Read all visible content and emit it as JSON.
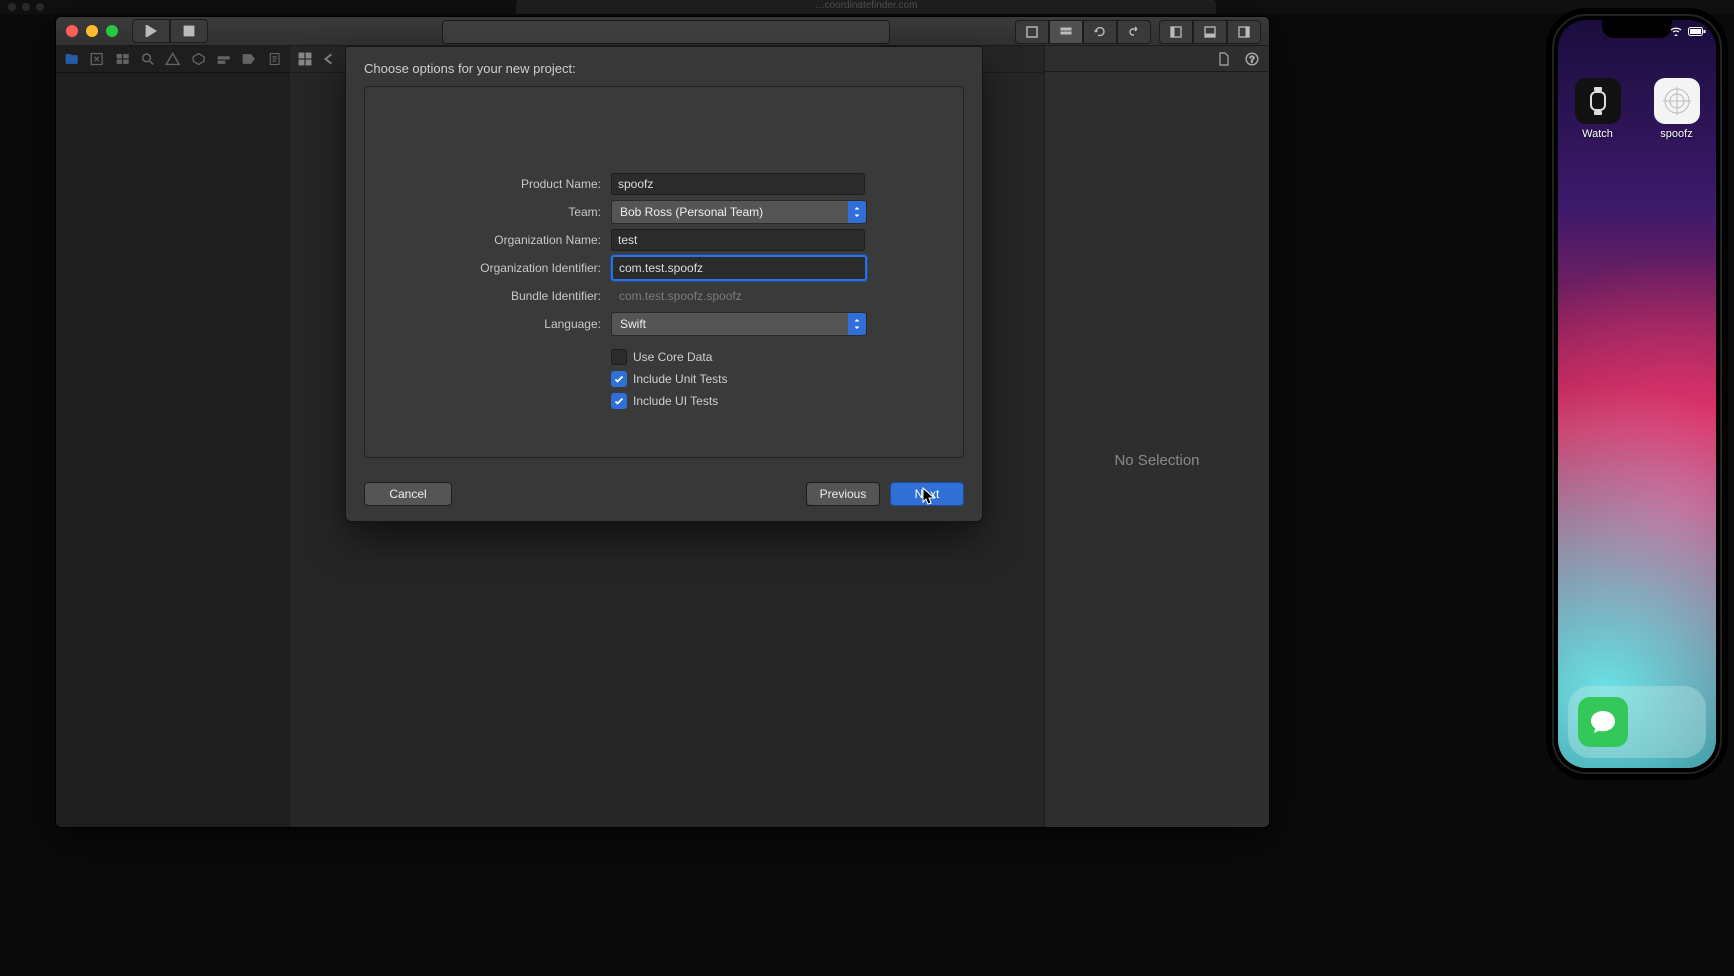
{
  "browser_url_ghost": "…coordinatefinder.com",
  "inspector": {
    "no_selection": "No Selection"
  },
  "sheet": {
    "title": "Choose options for your new project:",
    "labels": {
      "product": "Product Name:",
      "team": "Team:",
      "org_name": "Organization Name:",
      "org_id": "Organization Identifier:",
      "bundle": "Bundle Identifier:",
      "language": "Language:"
    },
    "values": {
      "product": "spoofz",
      "team": "Bob Ross (Personal Team)",
      "org_name": "test",
      "org_id": "com.test.spoofz",
      "bundle": "com.test.spoofz.spoofz",
      "language": "Swift"
    },
    "checks": {
      "core_data": {
        "label": "Use Core Data",
        "checked": false
      },
      "unit_tests": {
        "label": "Include Unit Tests",
        "checked": true
      },
      "ui_tests": {
        "label": "Include UI Tests",
        "checked": true
      }
    },
    "buttons": {
      "cancel": "Cancel",
      "previous": "Previous",
      "next": "Next"
    }
  },
  "simulator": {
    "apps": {
      "watch": "Watch",
      "spoofz": "spoofz"
    }
  }
}
